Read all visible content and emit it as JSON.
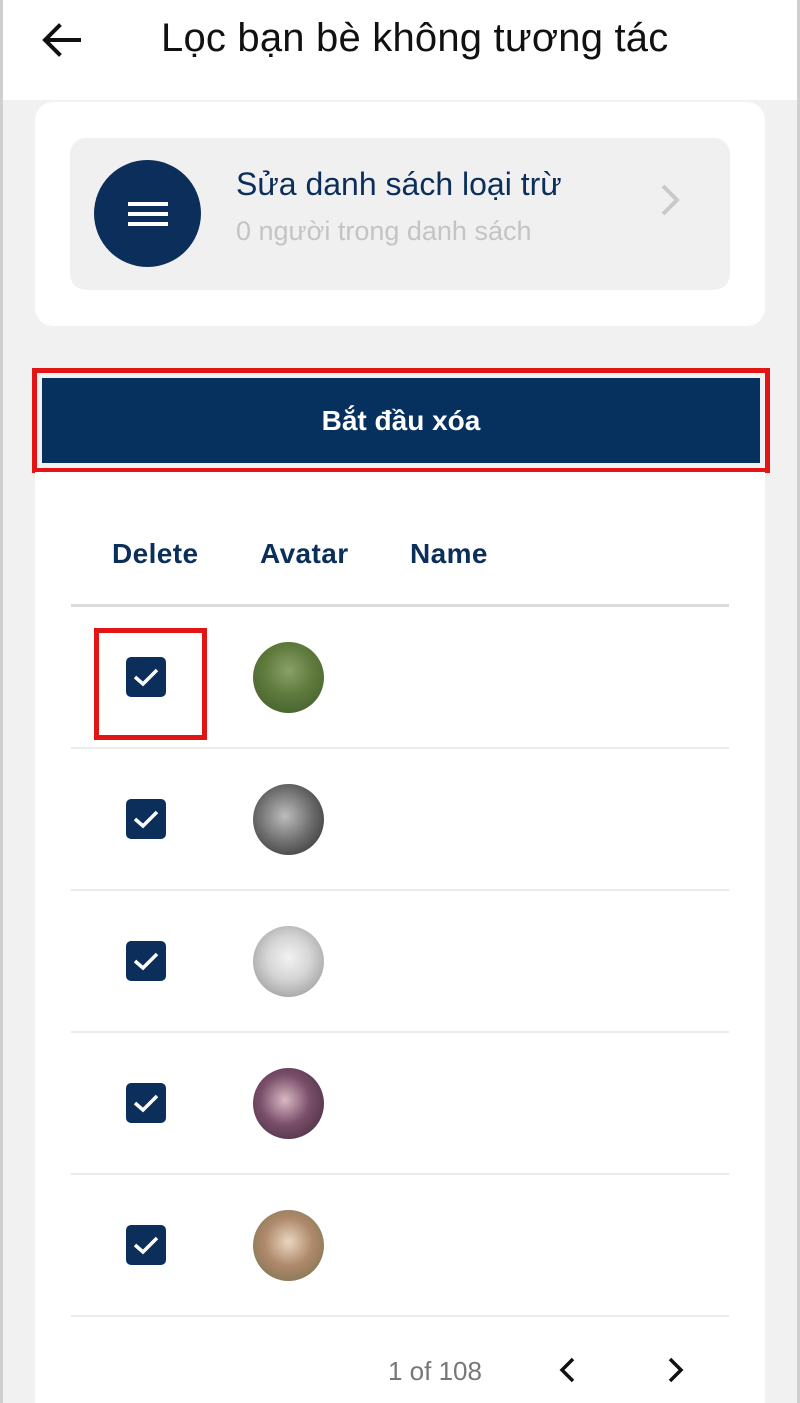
{
  "header": {
    "title": "Lọc bạn bè không tương tác",
    "back_icon": "arrow-left-icon"
  },
  "exclusion": {
    "title": "Sửa danh sách loại trừ",
    "subtitle": "0 người trong danh sách",
    "icon": "menu-icon",
    "chevron_icon": "chevron-right-icon"
  },
  "start_button": {
    "label": "Bắt đầu xóa"
  },
  "table": {
    "columns": [
      "Delete",
      "Avatar",
      "Name"
    ],
    "rows": [
      {
        "checked": true,
        "name": ""
      },
      {
        "checked": true,
        "name": ""
      },
      {
        "checked": true,
        "name": ""
      },
      {
        "checked": true,
        "name": ""
      },
      {
        "checked": true,
        "name": ""
      }
    ]
  },
  "pagination": {
    "text": "1 of 108",
    "prev_icon": "chevron-left-icon",
    "next_icon": "chevron-right-icon"
  },
  "colors": {
    "primary": "#0b2f5a",
    "highlight": "#e31414"
  }
}
